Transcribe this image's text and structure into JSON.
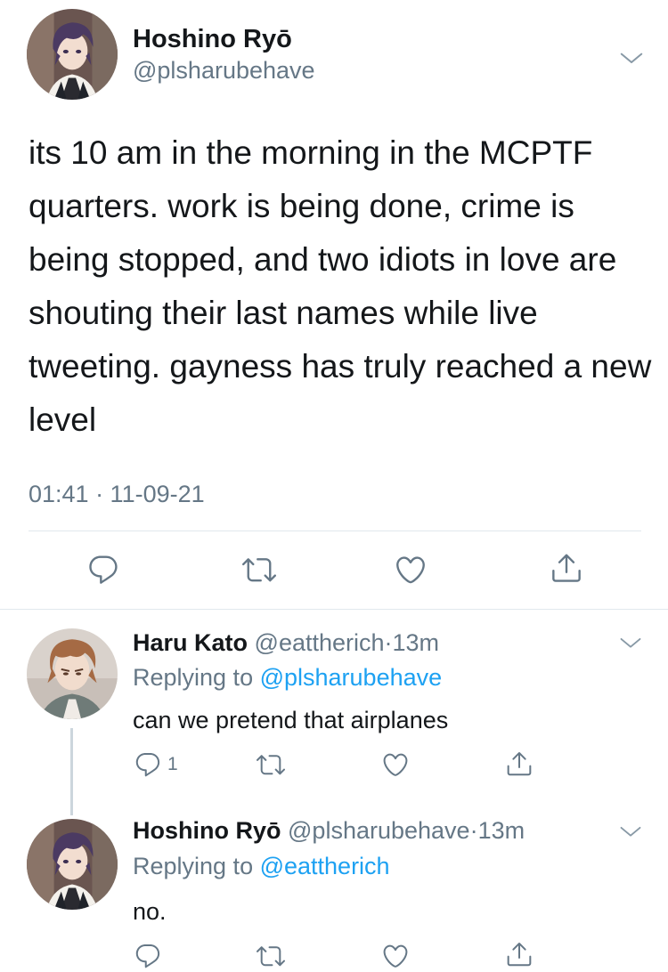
{
  "main_tweet": {
    "name": "Hoshino Ryō",
    "handle": "@plsharubehave",
    "text": "its 10 am in the morning in the MCPTF quarters. work is being done, crime is being stopped, and two idiots in love are shouting their last names while live tweeting. gayness has truly reached a new level",
    "timestamp": "01:41 · 11-09-21",
    "actions": [
      "reply-icon",
      "retweet-icon",
      "like-icon",
      "share-icon"
    ]
  },
  "replies": [
    {
      "name": "Haru Kato",
      "handle": "@eattherich",
      "time": "13m",
      "replying_prefix": "Replying to ",
      "replying_to": "@plsharubehave",
      "text": "can we pretend that airplanes",
      "reply_count": "1"
    },
    {
      "name": "Hoshino Ryō",
      "handle": "@plsharubehave",
      "time": "13m",
      "replying_prefix": "Replying to ",
      "replying_to": "@eattherich",
      "text": "no."
    }
  ],
  "colors": {
    "text": "#14171a",
    "secondary": "#657786",
    "link": "#1da1f2",
    "divider": "#e1e8ed"
  }
}
